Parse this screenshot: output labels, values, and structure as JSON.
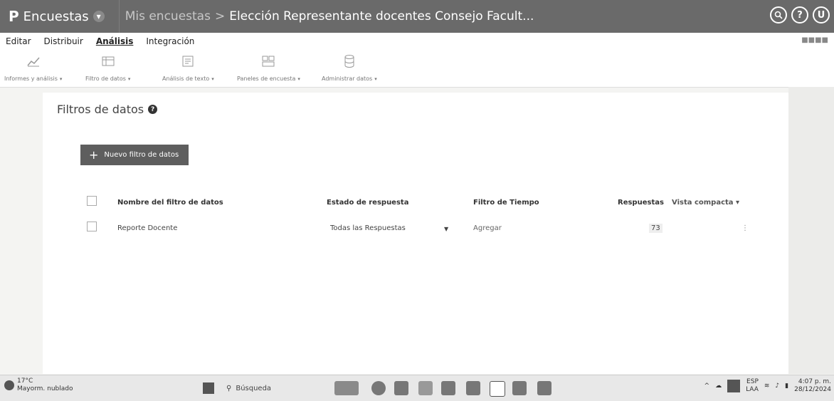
{
  "header": {
    "app_name": "Encuestas",
    "breadcrumb_parent": "Mis encuestas",
    "breadcrumb_sep": ">",
    "breadcrumb_current": "Elección Representante docentes Consejo Facult...",
    "icons": [
      "search-icon",
      "help-icon",
      "user-icon"
    ],
    "user_initial": "U"
  },
  "tabs": [
    {
      "label": "Editar"
    },
    {
      "label": "Distribuir"
    },
    {
      "label": "Análisis"
    },
    {
      "label": "Integración"
    }
  ],
  "ribbon": [
    {
      "label": "Informes y análisis",
      "icon": "chart-icon"
    },
    {
      "label": "Filtro de datos",
      "icon": "filter-icon"
    },
    {
      "label": "Análisis de texto",
      "icon": "text-analysis-icon"
    },
    {
      "label": "Paneles de encuesta",
      "icon": "dashboard-icon"
    },
    {
      "label": "Administrar datos",
      "icon": "database-icon"
    }
  ],
  "main": {
    "title": "Filtros de datos",
    "new_filter_button": "Nuevo filtro de datos",
    "table": {
      "headers": {
        "name": "Nombre del filtro de datos",
        "state": "Estado de respuesta",
        "time": "Filtro de Tiempo",
        "responses": "Respuestas",
        "view": "Vista compacta"
      },
      "rows": [
        {
          "name": "Reporte Docente",
          "state": "Todas las Respuestas",
          "time": "Agregar",
          "responses": "73"
        }
      ]
    }
  },
  "taskbar": {
    "temperature": "17°C",
    "weather": "Mayorm. nublado",
    "search_placeholder": "Búsqueda",
    "language": "ESP",
    "region": "LAA",
    "time": "4:07 p. m.",
    "date": "28/12/2024"
  },
  "colors": {
    "topbar": "#6a6a6a",
    "button": "#5e5e5e",
    "background": "#f4f4f2"
  }
}
